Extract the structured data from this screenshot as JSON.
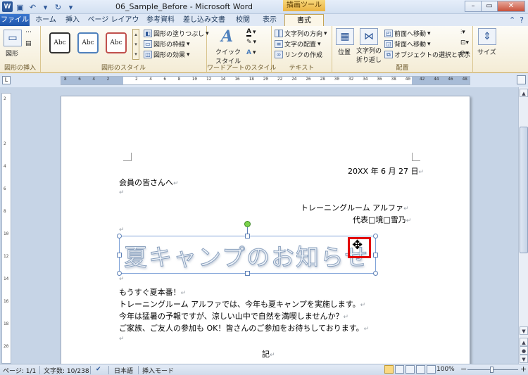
{
  "window": {
    "title": "06_Sample_Before - Microsoft Word",
    "context_tab_title": "描画ツール",
    "app_letter": "W"
  },
  "tabs": [
    {
      "label": "ファイル"
    },
    {
      "label": "ホーム"
    },
    {
      "label": "挿入"
    },
    {
      "label": "ページ レイアウト"
    },
    {
      "label": "参考資料"
    },
    {
      "label": "差し込み文書"
    },
    {
      "label": "校閲"
    },
    {
      "label": "表示"
    },
    {
      "label": "書式"
    }
  ],
  "ribbon": {
    "insert_shapes": {
      "shape_label": "図形",
      "group_label": "図形の挿入"
    },
    "shape_styles": {
      "sample_text": "Abc",
      "fill": "図形の塗りつぶし",
      "outline": "図形の枠線",
      "effects": "図形の効果",
      "group_label": "図形のスタイル"
    },
    "wordart": {
      "quick_style_line1": "クイック",
      "quick_style_line2": "スタイル",
      "group_label": "ワードアートのスタイル"
    },
    "text": {
      "direction": "文字列の方向",
      "align": "文字の配置",
      "link": "リンクの作成",
      "group_label": "テキスト"
    },
    "arrange": {
      "position": "位置",
      "wrap_line1": "文字列の",
      "wrap_line2": "折り返し",
      "bring_forward": "前面へ移動",
      "send_backward": "背面へ移動",
      "selection_pane": "オブジェクトの選択と表示",
      "group_label": "配置"
    },
    "size": {
      "label": "サイズ"
    }
  },
  "ruler": {
    "ticks": [
      "8",
      "6",
      "4",
      "2",
      "",
      "2",
      "4",
      "6",
      "8",
      "10",
      "12",
      "14",
      "16",
      "18",
      "20",
      "22",
      "24",
      "26",
      "28",
      "30",
      "32",
      "34",
      "36",
      "38",
      "40",
      "42",
      "44",
      "46",
      "48"
    ],
    "vticks": [
      "2",
      "",
      "2",
      "4",
      "6",
      "8",
      "10",
      "12",
      "14",
      "16",
      "18",
      "20"
    ]
  },
  "document": {
    "date": "20XX 年 6 月 27 日",
    "salutation": "会員の皆さんへ",
    "org": "トレーニングルーム アルファ",
    "rep": "代表□境□雪乃",
    "wordart_text": "夏キャンプのお知らせ",
    "body": [
      "もうすぐ夏本番！",
      "トレーニングルーム アルファでは、今年も夏キャンプを実施します。",
      "今年は猛暑の予報ですが、涼しい山中で自然を満喫しませんか？",
      "ご家族、ご友人の参加も OK！皆さんのご参加をお待ちしております。"
    ],
    "ki": "記",
    "para_mark": "↵"
  },
  "statusbar": {
    "page": "ページ: 1/1",
    "words": "文字数: 10/238",
    "language": "日本語",
    "mode": "挿入モード",
    "zoom": "100%",
    "minus": "−",
    "plus": "+"
  }
}
